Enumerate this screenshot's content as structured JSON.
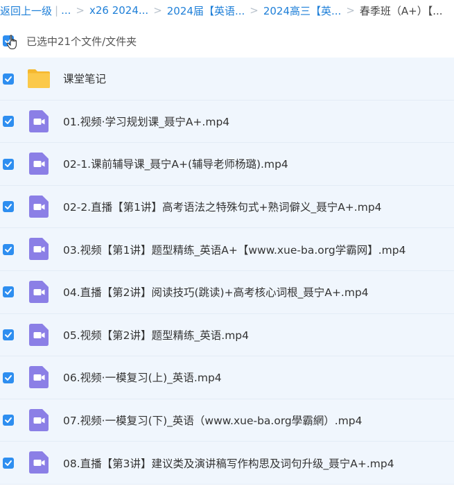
{
  "breadcrumb": {
    "back": "返回上一级",
    "separator_bar": "|",
    "items": [
      "...",
      "x26 2024...",
      "2024届【英语...",
      "2024高三【英...",
      "春季班（A+）【..."
    ]
  },
  "selection": {
    "label": "已选中21个文件/文件夹"
  },
  "files": [
    {
      "name": "课堂笔记",
      "type": "folder",
      "checked": true
    },
    {
      "name": "01.视频·学习规划课_聂宁A+.mp4",
      "type": "video",
      "checked": true
    },
    {
      "name": "02-1.课前辅导课_聂宁A+(辅导老师杨璐).mp4",
      "type": "video",
      "checked": true
    },
    {
      "name": "02-2.直播【第1讲】高考语法之特殊句式+熟词僻义_聂宁A+.mp4",
      "type": "video",
      "checked": true
    },
    {
      "name": "03.视频【第1讲】题型精练_英语A+【www.xue-ba.org学霸网】.mp4",
      "type": "video",
      "checked": true
    },
    {
      "name": "04.直播【第2讲】阅读技巧(跳读)+高考核心词根_聂宁A+.mp4",
      "type": "video",
      "checked": true
    },
    {
      "name": "05.视频【第2讲】题型精练_英语.mp4",
      "type": "video",
      "checked": true
    },
    {
      "name": "06.视频·一模复习(上)_英语.mp4",
      "type": "video",
      "checked": true
    },
    {
      "name": "07.视频·一模复习(下)_英语（www.xue-ba.org學霸網）.mp4",
      "type": "video",
      "checked": true
    },
    {
      "name": "08.直播【第3讲】建议类及演讲稿写作构思及词句升级_聂宁A+.mp4",
      "type": "video",
      "checked": true
    }
  ],
  "colors": {
    "link": "#1e7fd8",
    "checkbox": "#2e8ef0",
    "row_bg": "#f0f6fd",
    "folder": "#fbc94a",
    "video_icon": "#8b7fe6"
  },
  "icons": {
    "folder": "folder-icon",
    "video": "video-file-icon",
    "cursor": "hand-pointer-icon",
    "check": "checkmark-icon"
  }
}
